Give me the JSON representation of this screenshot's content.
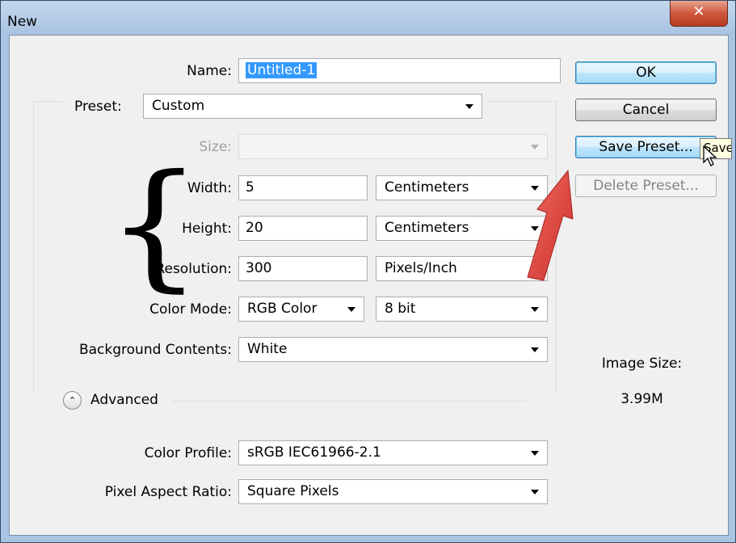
{
  "window": {
    "title": "New",
    "close_glyph": "✕"
  },
  "form": {
    "name_label": "Name:",
    "name_value": "Untitled-1",
    "preset_label": "Preset:",
    "preset_value": "Custom",
    "size_label": "Size:",
    "size_value": "",
    "width_label": "Width:",
    "width_value": "5",
    "width_unit": "Centimeters",
    "height_label": "Height:",
    "height_value": "20",
    "height_unit": "Centimeters",
    "resolution_label": "Resolution:",
    "resolution_value": "300",
    "resolution_unit": "Pixels/Inch",
    "color_mode_label": "Color Mode:",
    "color_mode_value": "RGB Color",
    "bit_depth_value": "8 bit",
    "background_label": "Background Contents:",
    "background_value": "White",
    "advanced_label": "Advanced",
    "advanced_glyph": "⌃",
    "color_profile_label": "Color Profile:",
    "color_profile_value": "sRGB IEC61966-2.1",
    "pixel_aspect_label": "Pixel Aspect Ratio:",
    "pixel_aspect_value": "Square Pixels"
  },
  "buttons": {
    "ok": "OK",
    "cancel": "Cancel",
    "save_preset": "Save Preset...",
    "delete_preset": "Delete Preset..."
  },
  "info": {
    "image_size_label": "Image Size:",
    "image_size_value": "3.99M"
  },
  "tooltip": {
    "text": "Save Preset"
  },
  "annotation": {
    "brace_glyph": "{"
  },
  "icons": [
    "close-icon",
    "dropdown-arrow-icon",
    "collapse-chevron-icon",
    "mouse-cursor-icon",
    "red-arrow-icon"
  ],
  "colors": {
    "selection": "#3399ff",
    "arrow": "#e8453c",
    "titlebar": "#a9c4e2"
  }
}
